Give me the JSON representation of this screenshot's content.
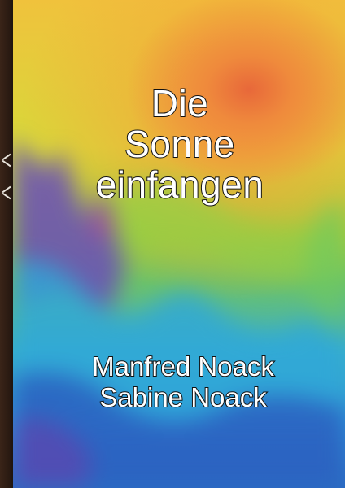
{
  "cover": {
    "title_lines": [
      "Die",
      "Sonne",
      "einfangen"
    ],
    "authors": [
      "Manfred Noack",
      "Sabine Noack"
    ]
  },
  "colors": {
    "sun_orange": "#ef8a3c",
    "yellow": "#f0c23c",
    "green": "#9ccf3c",
    "cyan": "#3ab0c8",
    "blue": "#2b6fc4",
    "purple": "#6a4cb8",
    "spine": "#2a1a12"
  }
}
